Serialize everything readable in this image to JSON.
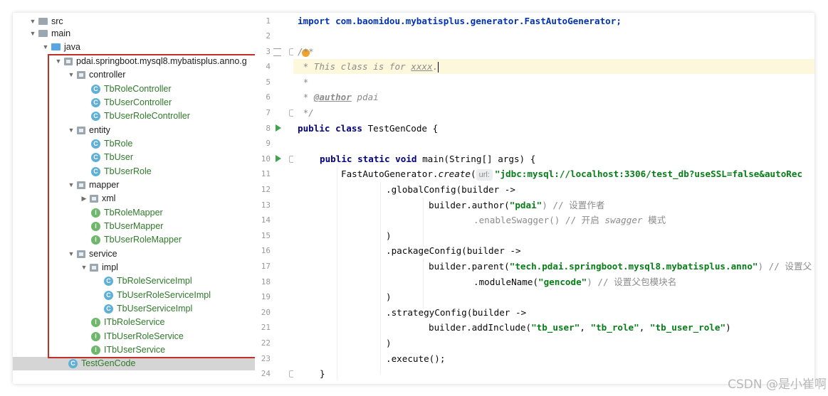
{
  "tree": {
    "items": [
      {
        "label": "src",
        "kind": "folder"
      },
      {
        "label": "main",
        "kind": "folder"
      },
      {
        "label": "java",
        "kind": "folder-blue"
      },
      {
        "label": "pdai.springboot.mysql8.mybatisplus.anno.g",
        "kind": "package"
      },
      {
        "label": "controller",
        "kind": "package"
      },
      {
        "label": "TbRoleController",
        "kind": "class"
      },
      {
        "label": "TbUserController",
        "kind": "class"
      },
      {
        "label": "TbUserRoleController",
        "kind": "class"
      },
      {
        "label": "entity",
        "kind": "package"
      },
      {
        "label": "TbRole",
        "kind": "class"
      },
      {
        "label": "TbUser",
        "kind": "class"
      },
      {
        "label": "TbUserRole",
        "kind": "class"
      },
      {
        "label": "mapper",
        "kind": "package"
      },
      {
        "label": "xml",
        "kind": "package"
      },
      {
        "label": "TbRoleMapper",
        "kind": "interface"
      },
      {
        "label": "TbUserMapper",
        "kind": "interface"
      },
      {
        "label": "TbUserRoleMapper",
        "kind": "interface"
      },
      {
        "label": "service",
        "kind": "package"
      },
      {
        "label": "impl",
        "kind": "package"
      },
      {
        "label": "TbRoleServiceImpl",
        "kind": "class"
      },
      {
        "label": "TbUserRoleServiceImpl",
        "kind": "class"
      },
      {
        "label": "TbUserServiceImpl",
        "kind": "class"
      },
      {
        "label": "ITbRoleService",
        "kind": "interface"
      },
      {
        "label": "ITbUserRoleService",
        "kind": "interface"
      },
      {
        "label": "ITbUserService",
        "kind": "interface"
      },
      {
        "label": "TestGenCode",
        "kind": "class-selected"
      }
    ],
    "class_badge": "C",
    "interface_badge": "I"
  },
  "gutter": {
    "line_numbers": [
      "1",
      "2",
      "3",
      "4",
      "5",
      "6",
      "7",
      "8",
      "9",
      "10",
      "11",
      "12",
      "13",
      "14",
      "15",
      "16",
      "17",
      "18",
      "19",
      "20",
      "21",
      "22",
      "23",
      "24"
    ]
  },
  "editor": {
    "l1": "import com.baomidou.mybatisplus.generator.FastAutoGenerator;",
    "l3": "/**",
    "l4_a": " * This class is for ",
    "l4_b": "xxxx",
    "l4_c": ".",
    "l5": " *",
    "l6_a": " * ",
    "l6_b": "@author",
    "l6_c": " pdai",
    "l7": " */",
    "l8_kw": "public class",
    "l8_rest": " TestGenCode {",
    "l10_kw": "public static void",
    "l10_rest": " main(String[] args) {",
    "l11_a": "FastAutoGenerator.",
    "l11_b": "create",
    "l11_c": "(",
    "l11_hint": "url:",
    "l11_str": "\"jdbc:mysql://localhost:3306/test_db?useSSL=false&autoRec",
    "l12": ".globalConfig(builder ->",
    "l13_a": "builder.author(",
    "l13_str": "\"pdai\"",
    "l13_c": ") // 设置作者",
    "l14_a": ".enableSwagger() // 开启 ",
    "l14_b": "swagger",
    "l14_c": " 模式",
    "l15": ")",
    "l16": ".packageConfig(builder ->",
    "l17_a": "builder.parent(",
    "l17_str": "\"tech.pdai.springboot.mysql8.mybatisplus.anno\"",
    "l17_c": ") // 设置父",
    "l18_a": ".moduleName(",
    "l18_str": "\"gencode\"",
    "l18_c": ") // 设置父包模块名",
    "l19": ")",
    "l20": ".strategyConfig(builder ->",
    "l21_a": "builder.addInclude(",
    "l21_s1": "\"tb_user\"",
    "l21_sep1": ", ",
    "l21_s2": "\"tb_role\"",
    "l21_sep2": ", ",
    "l21_s3": "\"tb_user_role\"",
    "l21_c": ")",
    "l22": ")",
    "l23": ".execute();",
    "l24": "}"
  },
  "watermark": "CSDN @是小崔啊",
  "colors": {
    "highlight_box": "#c0302b",
    "keyword": "#0033b3",
    "string": "#067d17",
    "comment": "#8c8c8c",
    "current_line": "#fdf8dc"
  }
}
